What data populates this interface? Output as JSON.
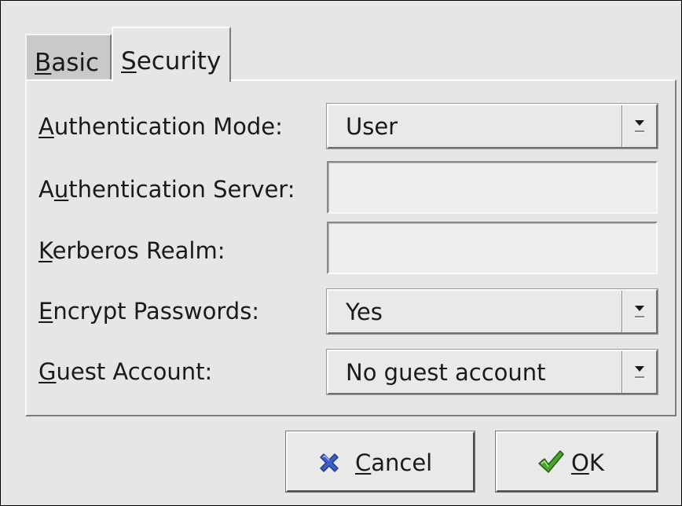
{
  "tabs": [
    {
      "label": "Basic",
      "mnemonic": "B",
      "rest": "asic",
      "active": false
    },
    {
      "label": "Security",
      "mnemonic": "S",
      "rest": "ecurity",
      "active": true
    }
  ],
  "form": {
    "authentication_mode": {
      "label": "Authentication Mode:",
      "mnemonic": "A",
      "rest": "uthentication Mode:",
      "value": "User"
    },
    "authentication_server": {
      "label": "Authentication Server:",
      "pre": "A",
      "mnemonic": "u",
      "rest": "thentication Server:",
      "value": ""
    },
    "kerberos_realm": {
      "label": "Kerberos Realm:",
      "mnemonic": "K",
      "rest": "erberos Realm:",
      "value": ""
    },
    "encrypt_passwords": {
      "label": "Encrypt Passwords:",
      "mnemonic": "E",
      "rest": "ncrypt Passwords:",
      "value": "Yes"
    },
    "guest_account": {
      "label": "Guest Account:",
      "mnemonic": "G",
      "rest": "uest Account:",
      "value": "No guest account"
    }
  },
  "buttons": {
    "cancel": {
      "label": "Cancel",
      "mnemonic": "C",
      "rest": "ancel",
      "icon": "close-x-icon",
      "icon_color": "#3d5fc4"
    },
    "ok": {
      "label": "OK",
      "mnemonic": "O",
      "rest": "K",
      "icon": "checkmark-icon",
      "icon_color": "#4aa62a"
    }
  }
}
